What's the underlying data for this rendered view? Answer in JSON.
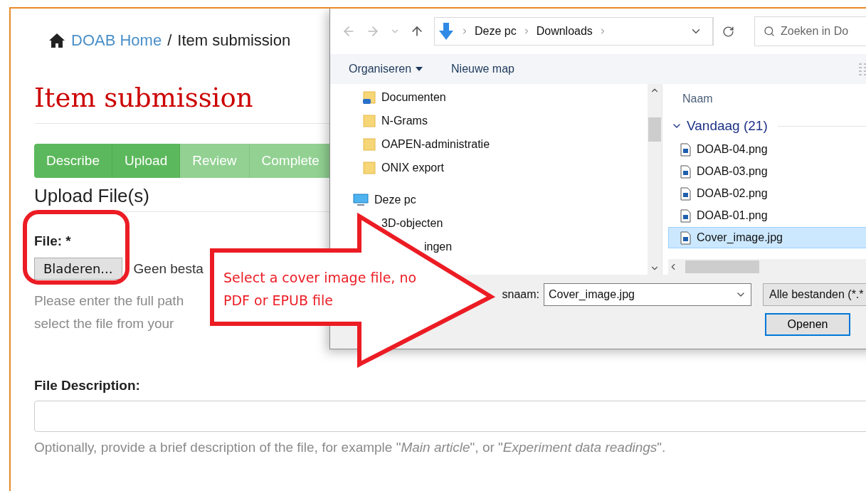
{
  "breadcrumb": {
    "home": "DOAB Home",
    "separator": "/",
    "current": "Item submission"
  },
  "title": "Item submission",
  "steps": [
    {
      "label": "Describe",
      "active": true
    },
    {
      "label": "Upload",
      "active": true
    },
    {
      "label": "Review",
      "active": false
    },
    {
      "label": "Complete",
      "active": false
    }
  ],
  "section_title": "Upload File(s)",
  "file_field": {
    "label": "File: *",
    "button": "Bladeren...",
    "status": "Geen besta",
    "help_lines": [
      "Please enter the full path",
      "select the file from your"
    ]
  },
  "description_field": {
    "label": "File Description:",
    "help": "Optionally, provide a brief description of the file, for example \"*Main article*\", or \"*Experiment data readings*\"."
  },
  "dialog": {
    "path": [
      "Deze pc",
      "Downloads"
    ],
    "search_placeholder": "Zoeken in Do",
    "toolbar": [
      "Organiseren",
      "Nieuwe map"
    ],
    "tree": [
      {
        "label": "Documenten",
        "kind": "linked-folder"
      },
      {
        "label": "N-Grams",
        "kind": "folder"
      },
      {
        "label": "OAPEN-administratie",
        "kind": "folder"
      },
      {
        "label": "ONIX export",
        "kind": "folder"
      },
      {
        "label": "Deze pc",
        "kind": "computer",
        "children": [
          {
            "label": "3D-objecten",
            "kind": "covered"
          },
          {
            "label": "ingen",
            "kind": "covered"
          }
        ]
      }
    ],
    "column": "Naam",
    "group": {
      "label": "Vandaag (21)",
      "expanded": true
    },
    "files": [
      {
        "name": "DOAB-04.png",
        "selected": false
      },
      {
        "name": "DOAB-03.png",
        "selected": false
      },
      {
        "name": "DOAB-02.png",
        "selected": false
      },
      {
        "name": "DOAB-01.png",
        "selected": false
      },
      {
        "name": "Cover_image.jpg",
        "selected": true
      }
    ],
    "filename_label": "snaam:",
    "filename": "Cover_image.jpg",
    "filter": "Alle bestanden (*.*",
    "open_button": "Openen"
  },
  "annotation": {
    "text": "Select a cover image file, no PDF or EPUB file"
  }
}
